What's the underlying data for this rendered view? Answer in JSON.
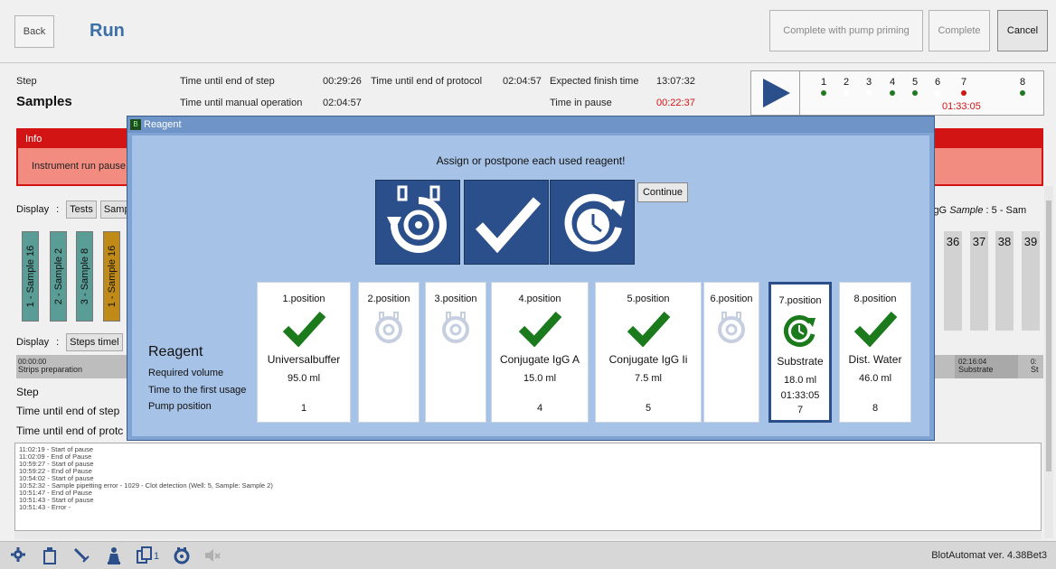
{
  "header": {
    "back_label": "Back",
    "title": "Run",
    "complete_priming_label": "Complete with pump priming",
    "complete_label": "Complete",
    "cancel_label": "Cancel"
  },
  "status": {
    "step_label": "Step",
    "step_value": "Samples",
    "time_end_step_label": "Time until end of step",
    "time_end_step_value": "00:29:26",
    "time_end_protocol_label": "Time until end of protocol",
    "time_end_protocol_value": "02:04:57",
    "expected_finish_label": "Expected finish time",
    "expected_finish_value": "13:07:32",
    "manual_op_label": "Time until manual operation",
    "manual_op_value": "02:04:57",
    "pause_label": "Time in pause",
    "pause_value": "00:22:37"
  },
  "positions": {
    "numbers": [
      "1",
      "2",
      "3",
      "4",
      "5",
      "6",
      "7",
      "8"
    ],
    "dot_colors": [
      "#1f7a1f",
      "#ffffff",
      "#ffffff",
      "#1f7a1f",
      "#1f7a1f",
      "#ffffff",
      "#d21414",
      "#1f7a1f"
    ],
    "pos7_time": "01:33:05"
  },
  "info": {
    "header": "Info",
    "message": "Instrument run pause"
  },
  "display": {
    "label": "Display",
    "colon": ":",
    "tests_btn": "Tests",
    "samples_btn": "Samp",
    "steps_btn": "Steps timel",
    "right_label_prefix": "lgG",
    "right_label_sample": "Sample",
    "right_label_value": ": 5 - Sam"
  },
  "strips": [
    {
      "label": "1 - Sample 16",
      "color": "#5a9c96"
    },
    {
      "label": "2 - Sample 2",
      "color": "#5a9c96"
    },
    {
      "label": "3 - Sample 8",
      "color": "#5a9c96"
    },
    {
      "label": "1 - Sample 16",
      "color": "#c08a18"
    }
  ],
  "right_numbers": [
    "36",
    "37",
    "38",
    "39"
  ],
  "timeline": {
    "left_time": "00:00:00",
    "left_name": "Strips preparation",
    "right_time": "02:16:04",
    "right_name": "Substrate",
    "far_time": "0:",
    "far_name": "St"
  },
  "left_labels": {
    "step": "Step",
    "time_end_step": "Time until end of step",
    "time_end_protocol": "Time until end of protc"
  },
  "log": [
    "11:02:19 - Start of pause",
    "11:02:09 - End of Pause",
    "10:59:27 - Start of pause",
    "10:59:22 - End of Pause",
    "10:54:02 - Start of pause",
    "10:52:32 - Sample pipetting error - 1029 - Clot detection (Well: 5, Sample: Sample 2)",
    "10:51:47 - End of Pause",
    "10:51:43 - Start of pause",
    "10:51:43 - Error -"
  ],
  "footer": {
    "copies_count": "1",
    "version": "BlotAutomat ver. 4.38Bet3"
  },
  "modal": {
    "title": "Reagent",
    "instruction": "Assign or postpone each used reagent!",
    "continue_label": "Continue",
    "reagent_label": "Reagent",
    "required_volume_label": "Required volume",
    "time_first_usage_label": "Time to the first usage",
    "pump_position_label": "Pump position",
    "cards": [
      {
        "pos": "1.position",
        "state": "assigned",
        "name": "Universalbuffer",
        "volume": "95.0 ml",
        "time": "",
        "pump": "1"
      },
      {
        "pos": "2.position",
        "state": "empty",
        "name": "",
        "volume": "",
        "time": "",
        "pump": ""
      },
      {
        "pos": "3.position",
        "state": "empty",
        "name": "",
        "volume": "",
        "time": "",
        "pump": ""
      },
      {
        "pos": "4.position",
        "state": "assigned",
        "name": "Conjugate IgG A",
        "volume": "15.0 ml",
        "time": "",
        "pump": "4"
      },
      {
        "pos": "5.position",
        "state": "assigned",
        "name": "Conjugate IgG Ii",
        "volume": "7.5 ml",
        "time": "",
        "pump": "5"
      },
      {
        "pos": "6.position",
        "state": "empty",
        "name": "",
        "volume": "",
        "time": "",
        "pump": ""
      },
      {
        "pos": "7.position",
        "state": "postponed",
        "name": "Substrate",
        "volume": "18.0 ml",
        "time": "01:33:05",
        "pump": "7"
      },
      {
        "pos": "8.position",
        "state": "assigned",
        "name": "Dist. Water",
        "volume": "46.0 ml",
        "time": "",
        "pump": "8"
      }
    ]
  }
}
